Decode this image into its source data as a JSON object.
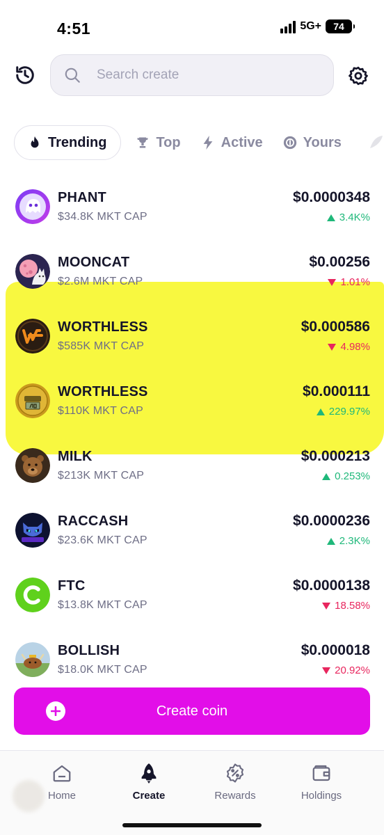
{
  "status_bar": {
    "time": "4:51",
    "network": "5G+",
    "battery": "74"
  },
  "search": {
    "placeholder": "Search create"
  },
  "tabs": [
    {
      "label": "Trending",
      "icon": "flame-icon"
    },
    {
      "label": "Top",
      "icon": "trophy-icon"
    },
    {
      "label": "Active",
      "icon": "bolt-icon"
    },
    {
      "label": "Yours",
      "icon": "coins-icon"
    }
  ],
  "coins": [
    {
      "name": "PHANT",
      "cap": "$34.8K MKT CAP",
      "price": "$0.0000348",
      "change": "3.4K%",
      "direction": "up",
      "avatar": "ghost-avatar"
    },
    {
      "name": "MOONCAT",
      "cap": "$2.6M MKT CAP",
      "price": "$0.00256",
      "change": "1.01%",
      "direction": "down",
      "avatar": "cat-moon-avatar"
    },
    {
      "name": "WORTHLESS",
      "cap": "$585K MKT CAP",
      "price": "$0.000586",
      "change": "4.98%",
      "direction": "down",
      "avatar": "w-logo-avatar"
    },
    {
      "name": "WORTHLESS",
      "cap": "$110K MKT CAP",
      "price": "$0.000111",
      "change": "229.97%",
      "direction": "up",
      "avatar": "coin-2-avatar"
    },
    {
      "name": "MILK",
      "cap": "$213K MKT CAP",
      "price": "$0.000213",
      "change": "0.253%",
      "direction": "up",
      "avatar": "bear-avatar"
    },
    {
      "name": "RACCASH",
      "cap": "$23.6K MKT CAP",
      "price": "$0.0000236",
      "change": "2.3K%",
      "direction": "up",
      "avatar": "raccoon-avatar"
    },
    {
      "name": "FTC",
      "cap": "$13.8K MKT CAP",
      "price": "$0.0000138",
      "change": "18.58%",
      "direction": "down",
      "avatar": "c-logo-avatar"
    },
    {
      "name": "BOLLISH",
      "cap": "$18.0K MKT CAP",
      "price": "$0.000018",
      "change": "20.92%",
      "direction": "down",
      "avatar": "bull-avatar"
    }
  ],
  "create_button": {
    "label": "Create coin"
  },
  "bottom_nav": [
    {
      "label": "Home",
      "icon": "home-icon"
    },
    {
      "label": "Create",
      "icon": "rocket-icon"
    },
    {
      "label": "Rewards",
      "icon": "percent-badge-icon"
    },
    {
      "label": "Holdings",
      "icon": "wallet-icon"
    }
  ],
  "colors": {
    "accent": "#e20ee8",
    "up": "#1fb87a",
    "down": "#e8265e",
    "highlight": "#f7f726"
  }
}
